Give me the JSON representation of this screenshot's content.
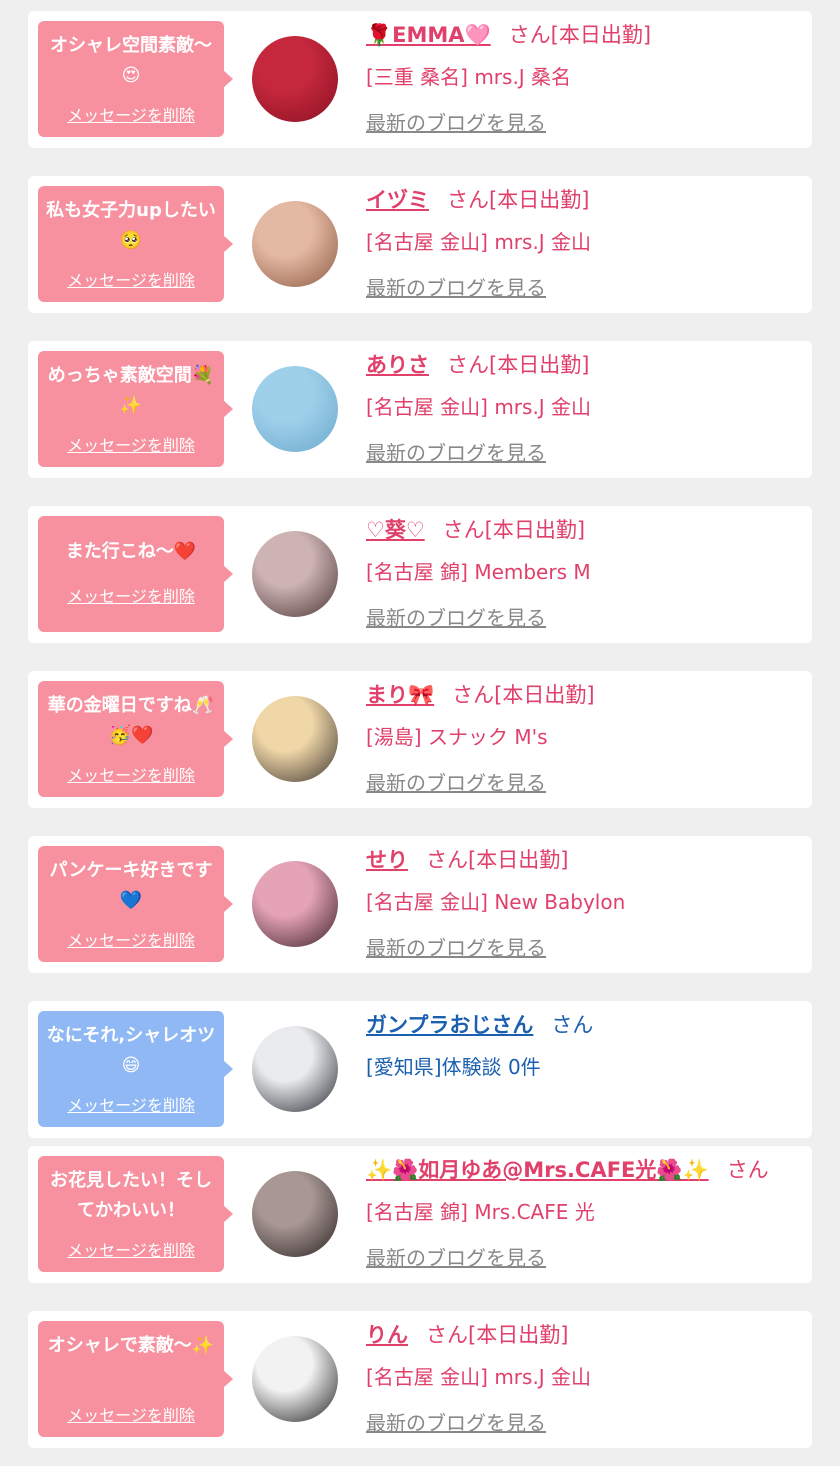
{
  "items": [
    {
      "theme": "pink",
      "message": "オシャレ空間素敵〜😍",
      "delete_label": "メッセージを削除",
      "name": "🌹EMMA🩷",
      "suffix": "さん[本日出勤]",
      "store": "[三重 桑名] mrs.J 桑名",
      "blog_label": "最新のブログを見る",
      "avatar_colors": [
        "#c5283c",
        "#8a1024"
      ]
    },
    {
      "theme": "pink",
      "message": "私も女子力upしたい🥺",
      "delete_label": "メッセージを削除",
      "name": "イヅミ",
      "suffix": "さん[本日出勤]",
      "store": "[名古屋 金山] mrs.J 金山",
      "blog_label": "最新のブログを見る",
      "avatar_colors": [
        "#e4b9a3",
        "#8c5a44"
      ]
    },
    {
      "theme": "pink",
      "message": "めっちゃ素敵空間💐✨",
      "delete_label": "メッセージを削除",
      "name": "ありさ",
      "suffix": "さん[本日出勤]",
      "store": "[名古屋 金山] mrs.J 金山",
      "blog_label": "最新のブログを見る",
      "avatar_colors": [
        "#9fd0ea",
        "#6aa8cc"
      ]
    },
    {
      "theme": "pink",
      "message": "また行こね〜❤️",
      "delete_label": "メッセージを削除",
      "name": "♡葵♡",
      "suffix": "さん[本日出勤]",
      "store": "[名古屋 錦] Members M",
      "blog_label": "最新のブログを見る",
      "avatar_colors": [
        "#cdb3b3",
        "#4a3535"
      ]
    },
    {
      "theme": "pink",
      "message": "華の金曜日ですね🥂🥳❤️",
      "delete_label": "メッセージを削除",
      "name": "まり🎀",
      "suffix": "さん[本日出勤]",
      "store": "[湯島] スナック M's",
      "blog_label": "最新のブログを見る",
      "avatar_colors": [
        "#f0d7a8",
        "#3d3530"
      ]
    },
    {
      "theme": "pink",
      "message": "パンケーキ好きです💙",
      "delete_label": "メッセージを削除",
      "name": "せり",
      "suffix": "さん[本日出勤]",
      "store": "[名古屋 金山] New Babylon",
      "blog_label": "最新のブログを見る",
      "avatar_colors": [
        "#e5a3b6",
        "#3a2027"
      ]
    },
    {
      "theme": "blue",
      "message": "なにそれ,シャレオツ😄",
      "delete_label": "メッセージを削除",
      "name": "ガンプラおじさん",
      "suffix": "さん",
      "store": "[愛知県]体験談 0件",
      "blog_label": "",
      "avatar_colors": [
        "#e9ebee",
        "#26292f"
      ]
    },
    {
      "theme": "pink",
      "message": "お花見したい！そしてかわいい！",
      "delete_label": "メッセージを削除",
      "name": "✨🌺如月ゆあ@Mrs.CAFE光🌺✨",
      "suffix": "さん",
      "store": "[名古屋 錦] Mrs.CAFE 光",
      "blog_label": "最新のブログを見る",
      "avatar_colors": [
        "#a89793",
        "#2a2222"
      ]
    },
    {
      "theme": "pink",
      "message": "オシャレで素敵〜✨",
      "delete_label": "メッセージを削除",
      "name": "りん",
      "suffix": "さん[本日出勤]",
      "store": "[名古屋 金山] mrs.J 金山",
      "blog_label": "最新のブログを見る",
      "avatar_colors": [
        "#f2f2f2",
        "#202020"
      ]
    }
  ]
}
